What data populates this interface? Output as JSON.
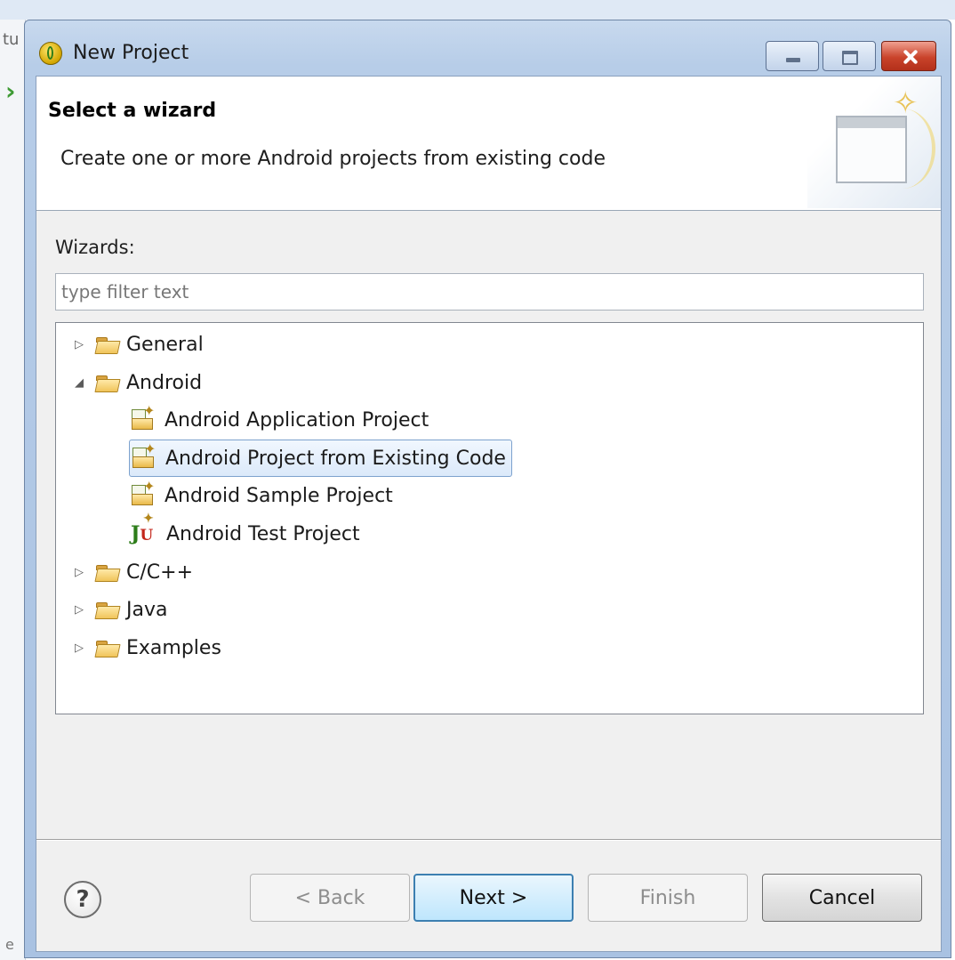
{
  "background": {
    "fragment_top": "tu",
    "fragment_bottom": "e"
  },
  "window": {
    "title": "New Project",
    "title_icon": "eclipse-juno-icon",
    "controls": [
      "minimize-icon",
      "maximize-icon",
      "close-icon"
    ]
  },
  "banner": {
    "title": "Select a wizard",
    "description": "Create one or more Android projects from existing code",
    "graphic": "new-wizard-banner-icon"
  },
  "wizards": {
    "label": "Wizards:",
    "filter_placeholder": "type filter text",
    "filter_value": "",
    "tree": [
      {
        "label": "General",
        "expanded": false,
        "icon": "folder-icon"
      },
      {
        "label": "Android",
        "expanded": true,
        "icon": "folder-icon",
        "children": [
          {
            "label": "Android Application Project",
            "icon": "android-project-icon"
          },
          {
            "label": "Android Project from Existing Code",
            "icon": "android-project-icon",
            "selected": true
          },
          {
            "label": "Android Sample Project",
            "icon": "android-project-icon"
          },
          {
            "label": "Android Test Project",
            "icon": "junit-icon"
          }
        ]
      },
      {
        "label": "C/C++",
        "expanded": false,
        "icon": "folder-icon"
      },
      {
        "label": "Java",
        "expanded": false,
        "icon": "folder-icon"
      },
      {
        "label": "Examples",
        "expanded": false,
        "icon": "folder-icon"
      }
    ],
    "expander_collapsed": "▷",
    "expander_expanded": "◢"
  },
  "buttons": {
    "help": "?",
    "back": "< Back",
    "next": "Next >",
    "finish": "Finish",
    "cancel": "Cancel"
  },
  "colors": {
    "title_bar": "#b7cde8",
    "selection": "#dbe9fa",
    "default_button_border": "#3c7fb1",
    "close_button": "#c9432b"
  }
}
